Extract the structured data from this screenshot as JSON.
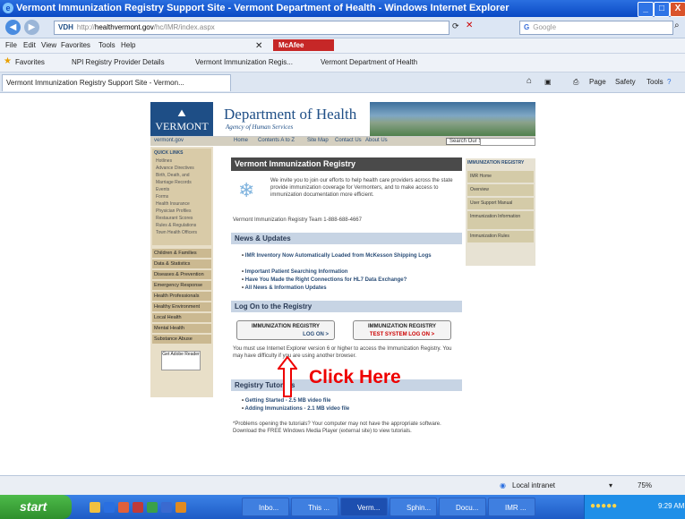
{
  "window": {
    "title": "Vermont Immunization Registry Support Site - Vermont Department of Health - Windows Internet Explorer",
    "controls": [
      "_",
      "□",
      "X"
    ]
  },
  "addressbar": {
    "url_prefix": "http://",
    "url_host": "healthvermont.gov",
    "url_path": "/hc/IMR/index.aspx",
    "search_placeholder": "Google"
  },
  "menubar": {
    "items": [
      "File",
      "Edit",
      "View",
      "Favorites",
      "Tools",
      "Help"
    ],
    "mcafee_label": "McAfee"
  },
  "favorites": {
    "label": "Favorites",
    "items": [
      "NPI Registry Provider Details",
      "Vermont Immunization Regis...",
      "Vermont Department of Health"
    ]
  },
  "tabs": {
    "active_tab": "Vermont Immunization Registry Support Site - Vermon...",
    "commands": [
      "Page",
      "Safety",
      "Tools"
    ]
  },
  "site": {
    "logo": "VERMONT",
    "dept_title": "Department of Health",
    "agency": "Agency of Human Services",
    "top_nav": [
      "vermont.gov",
      "Home",
      "Contents A to Z",
      "Site Map",
      "Contact Us",
      "About Us"
    ],
    "site_search": "Search Our Site",
    "left_nav": {
      "quick_links_title": "QUICK LINKS",
      "quick_links": [
        "Hotlines",
        "Advance Directives",
        "Birth, Death, and Marriage Records",
        "Events",
        "Forms",
        "Health Insurance",
        "Physician Profiles",
        "Restaurant Scores",
        "Rules & Regulations",
        "Town Health Officers"
      ],
      "sections": [
        "Children & Families",
        "Data & Statistics",
        "Diseases & Prevention",
        "Emergency Response",
        "Health Professionals",
        "Healthy Environment",
        "Local Health",
        "Mental Health",
        "Substance Abuse"
      ],
      "reader_label": "Get Adobe Reader"
    },
    "main": {
      "heading": "Vermont Immunization Registry",
      "intro": "We invite you to join our efforts to help health care providers across the state provide immunization coverage for Vermonters, and to make access to immunization documentation more efficient.",
      "team_line": "Vermont Immunization Registry Team 1-888-688-4667",
      "news_heading": "News & Updates",
      "news": [
        "IMR Inventory Now Automatically Loaded from McKesson Shipping Logs",
        "Important Patient Searching Information",
        "Have You Made the Right Connections for HL7 Data Exchange?",
        "All News & Information Updates"
      ],
      "logon_heading": "Log On to the Registry",
      "logon_button": {
        "title": "IMMUNIZATION REGISTRY",
        "sub": "LOG ON >"
      },
      "test_button": {
        "title": "IMMUNIZATION REGISTRY",
        "sub": "TEST SYSTEM   LOG ON >"
      },
      "logon_note": "You must use Internet Explorer version 6 or higher to access the Immunization Registry. You may have difficulty if you are using another browser.",
      "tutorials_heading": "Registry Tutorials",
      "tutorials": [
        "Getting Started - 2.5 MB video file",
        "Adding Immunizations - 2.1 MB video file"
      ],
      "tutorial_note": "*Problems opening the tutorials? Your computer may not have the appropriate software. Download the FREE Windows Media Player (external site) to view tutorials."
    },
    "right_nav": {
      "title": "IMMUNIZATION REGISTRY",
      "items": [
        "IMR Home",
        "Overview",
        "User Support Manual",
        "Immunization Information",
        "Immunization Rules"
      ]
    }
  },
  "annotation": {
    "text": "Click Here"
  },
  "statusbar": {
    "zone": "Local intranet",
    "zoom": "75%"
  },
  "taskbar": {
    "start": "start",
    "tasks": [
      "Inbo...",
      "This ...",
      "Verm...",
      "Sphin...",
      "Docu...",
      "IMR ..."
    ],
    "clock": "9:29 AM"
  }
}
